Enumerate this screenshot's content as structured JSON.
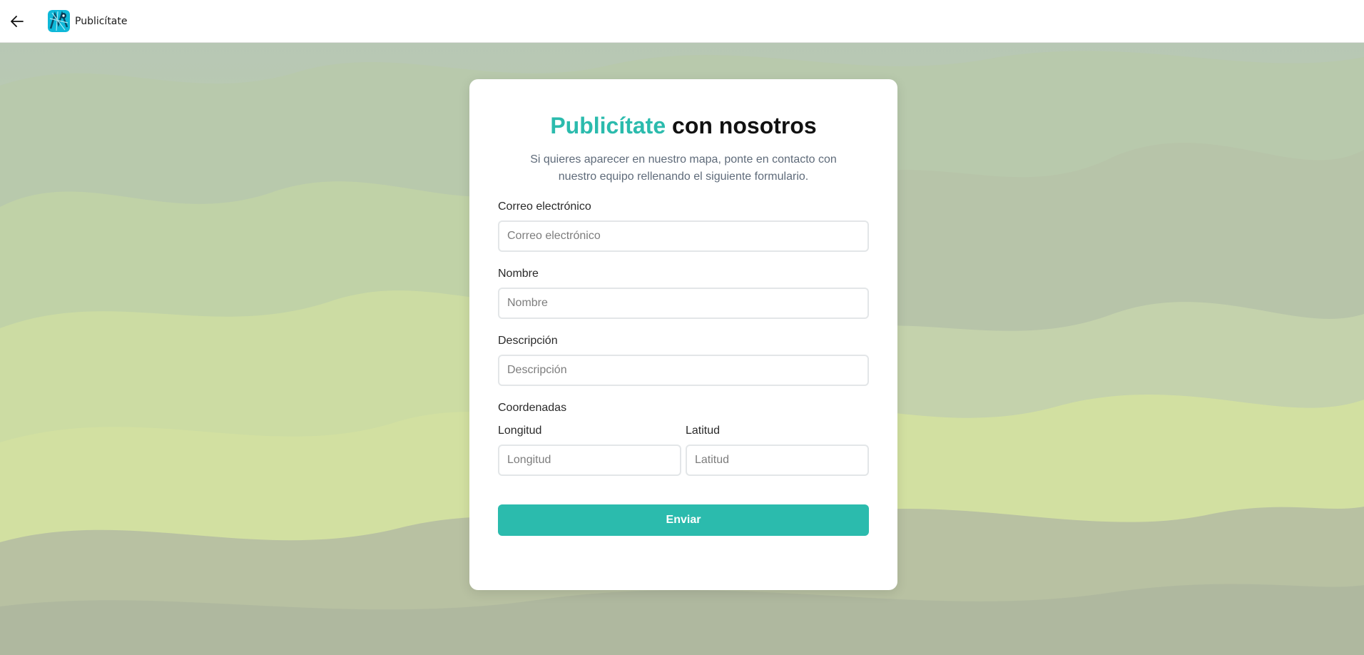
{
  "window": {
    "title": "Publicítate",
    "back_icon": "arrow-left-icon",
    "app_icon": "map-logo-icon"
  },
  "colors": {
    "accent": "#2bbbad",
    "subtitle": "#5f6b7a"
  },
  "form": {
    "title_accent": "Publicítate",
    "title_rest": " con nosotros",
    "subtitle": "Si quieres aparecer en nuestro mapa, ponte en contacto con nuestro equipo rellenando el siguiente formulario.",
    "email": {
      "label": "Correo electrónico",
      "placeholder": "Correo electrónico",
      "value": ""
    },
    "name": {
      "label": "Nombre",
      "placeholder": "Nombre",
      "value": ""
    },
    "description": {
      "label": "Descripción",
      "placeholder": "Descripción",
      "value": ""
    },
    "coordinates": {
      "label": "Coordenadas",
      "longitude": {
        "label": "Longitud",
        "placeholder": "Longitud",
        "value": ""
      },
      "latitude": {
        "label": "Latitud",
        "placeholder": "Latitud",
        "value": ""
      }
    },
    "submit_label": "Enviar"
  }
}
